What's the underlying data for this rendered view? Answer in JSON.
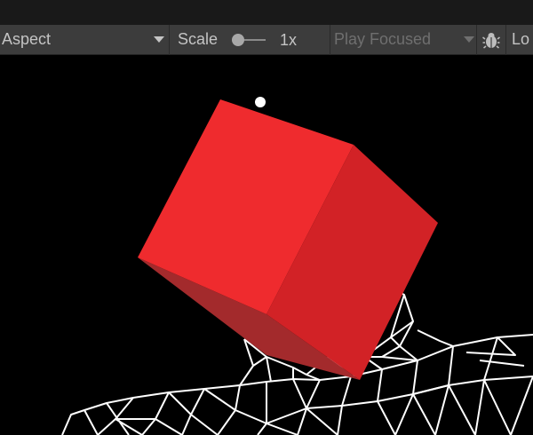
{
  "toolbar": {
    "aspect_label": "Aspect",
    "scale_label": "Scale",
    "scale_value": "1x",
    "play_mode_label": "Play Focused",
    "bug_icon": "bug-icon",
    "trailing_label": "Lo"
  },
  "scene": {
    "cube_color": "#e8262b",
    "cube_front_color": "#ef2b2e",
    "cube_side_color": "#d22226",
    "cube_bottom_color": "#a32a2c",
    "wireframe_color": "#ffffff",
    "marker_color": "#ffffff"
  }
}
